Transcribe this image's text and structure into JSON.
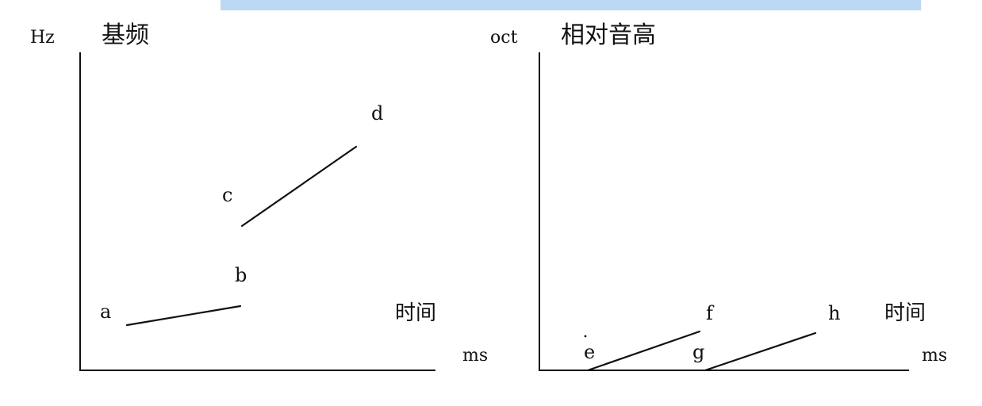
{
  "bar": {
    "color": "#bcd8f4"
  },
  "left_panel": {
    "y_unit": "Hz",
    "y_label": "基频",
    "x_label": "时间",
    "x_unit": "ms",
    "points": {
      "a": "a",
      "b": "b",
      "c": "c",
      "d": "d"
    }
  },
  "right_panel": {
    "y_unit": "oct",
    "y_label": "相对音高",
    "x_label": "时间",
    "x_unit": "ms",
    "points": {
      "e": "e",
      "f": "f",
      "g": "g",
      "h": "h"
    }
  }
}
